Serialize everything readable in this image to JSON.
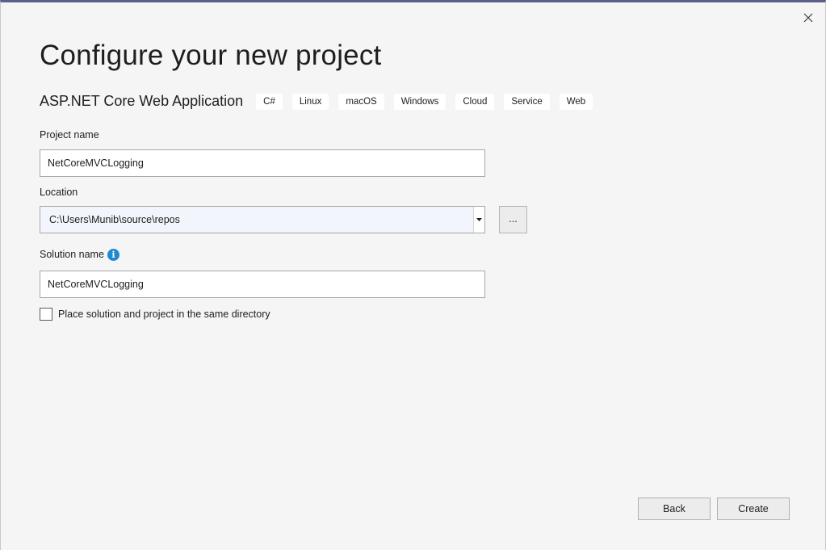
{
  "dialog": {
    "title": "Configure your new project"
  },
  "template": {
    "name": "ASP.NET Core Web Application",
    "tags": [
      "C#",
      "Linux",
      "macOS",
      "Windows",
      "Cloud",
      "Service",
      "Web"
    ]
  },
  "project_name": {
    "label": "Project name",
    "value": "NetCoreMVCLogging"
  },
  "location": {
    "label": "Location",
    "value": "C:\\Users\\Munib\\source\\repos",
    "browse_label": "..."
  },
  "solution_name": {
    "label": "Solution name",
    "info_glyph": "i",
    "value": "NetCoreMVCLogging"
  },
  "same_directory": {
    "label": "Place solution and project in the same directory",
    "checked": false
  },
  "buttons": {
    "back": "Back",
    "create": "Create"
  },
  "icons": {
    "close": "close-icon",
    "dropdown": "chevron-down-icon",
    "info": "info-icon"
  },
  "colors": {
    "title_bar_accent": "#5b5f8a",
    "info_icon": "#1f8ad2",
    "combo_background": "#f2f5fb"
  }
}
